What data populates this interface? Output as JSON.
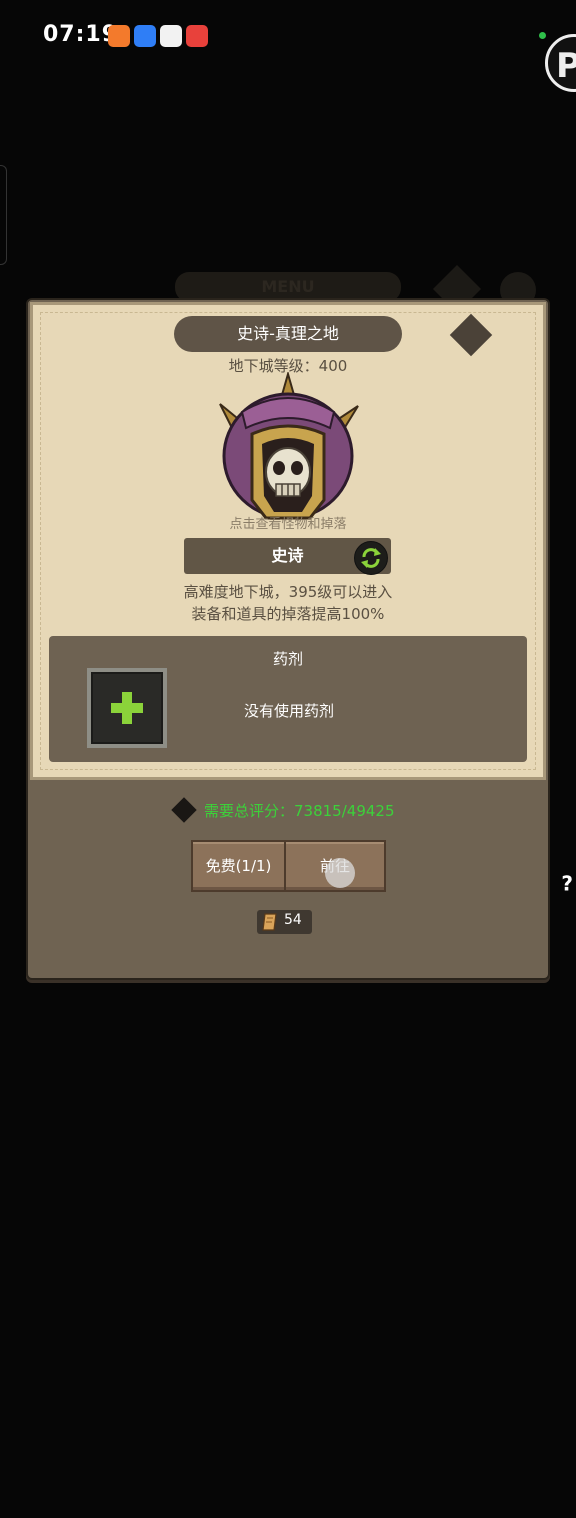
{
  "status_bar": {
    "time": "07:19",
    "app_icons": [
      {
        "name": "app-icon-orange",
        "color": "#f37a2c"
      },
      {
        "name": "app-icon-blue",
        "color": "#2f7ef6"
      },
      {
        "name": "app-icon-white",
        "color": "#f2f2f2"
      },
      {
        "name": "app-icon-red",
        "color": "#e8413b"
      }
    ],
    "corner_badge_letter": "P"
  },
  "background": {
    "header_text": "MENU"
  },
  "dungeon": {
    "title": "史诗-真理之地",
    "level_text": "地下城等级：400",
    "boss_caption": "点击查看怪物和掉落",
    "difficulty": "史诗",
    "description_line1": "高难度地下城，395级可以进入",
    "description_line2": "装备和道具的掉落提高100%"
  },
  "potion": {
    "title": "药剂",
    "empty_text": "没有使用药剂",
    "add_icon": "plus-icon"
  },
  "score": {
    "text": "需要总评分：73815/49425",
    "color": "#3cd23a"
  },
  "buttons": {
    "free_label": "免费(1/1)",
    "go_label": "前往"
  },
  "tickets": {
    "count": "54"
  },
  "colors": {
    "panel_bg": "#e7d8b7",
    "modal_bg": "#6f6352",
    "button_bg": "#8c725a",
    "accent_green": "#8bd33a"
  }
}
